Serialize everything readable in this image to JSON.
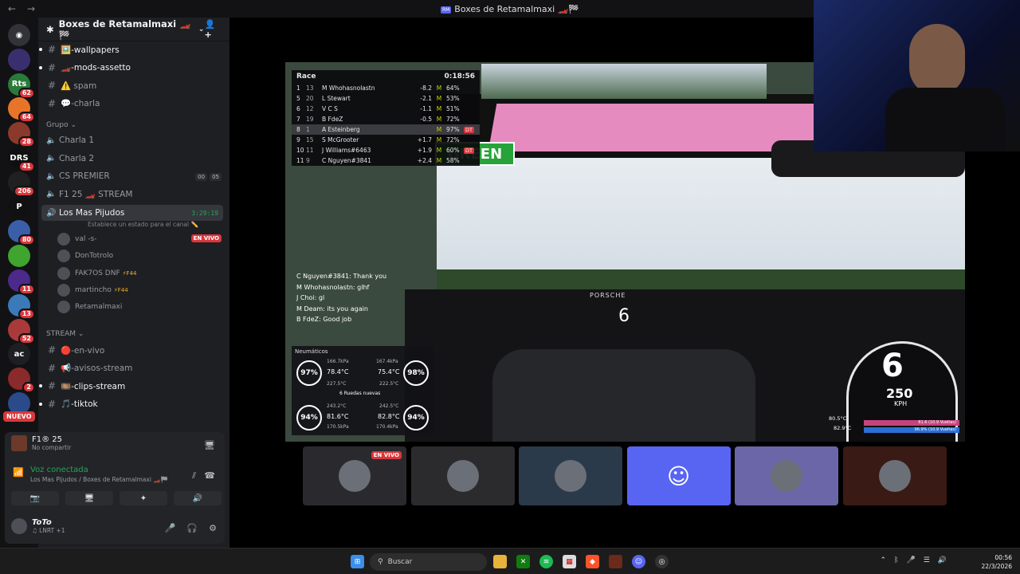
{
  "window": {
    "title": "Boxes de Retamalmaxi 🏎️🏁",
    "badge": "RM",
    "back": "←",
    "forward": "→"
  },
  "servers": [
    {
      "name": "discord-home",
      "count": "",
      "color": "#313338",
      "label": "◉"
    },
    {
      "name": "server-1",
      "count": "",
      "color": "#3a2f6e",
      "label": ""
    },
    {
      "name": "server-2",
      "count": "62",
      "color": "#2a7a3a",
      "label": "Rts"
    },
    {
      "name": "server-3",
      "count": "64",
      "color": "#e8742a",
      "label": ""
    },
    {
      "name": "server-4",
      "count": "28",
      "color": "#8a3a2a",
      "label": ""
    },
    {
      "name": "server-5",
      "count": "41",
      "color": "#101010",
      "label": "DRS"
    },
    {
      "name": "server-6",
      "count": "206",
      "color": "#202020",
      "label": ""
    },
    {
      "name": "server-7",
      "count": "",
      "color": "#111",
      "label": "P"
    },
    {
      "name": "server-8",
      "count": "80",
      "color": "#3a5fa8",
      "label": ""
    },
    {
      "name": "server-9",
      "count": "",
      "color": "#3fa52e",
      "label": ""
    },
    {
      "name": "server-10",
      "count": "11",
      "color": "#4b2a8a",
      "label": ""
    },
    {
      "name": "server-11",
      "count": "13",
      "color": "#3a7ab8",
      "label": ""
    },
    {
      "name": "server-12",
      "count": "52",
      "color": "#a83a3a",
      "label": ""
    },
    {
      "name": "server-13",
      "count": "",
      "color": "#1e1f22",
      "label": "ac"
    },
    {
      "name": "server-14",
      "count": "2",
      "color": "#8a2a2a",
      "label": ""
    },
    {
      "name": "server-15",
      "count": "",
      "color": "#2a4a8a",
      "label": ""
    }
  ],
  "new_badge": "NUEVO",
  "guild": {
    "name": "Boxes de Retamalmaxi 🏎️🏁",
    "chevron": "⌄",
    "invite_icon": "👤+"
  },
  "channels_top": [
    {
      "name": "🖼️-wallpapers",
      "bold": true
    },
    {
      "name": "🏎️-mods-assetto",
      "bold": true
    },
    {
      "name": "⚠️ spam",
      "bold": false
    },
    {
      "name": "💬-charla",
      "bold": false
    }
  ],
  "category_grupo": "Grupo ⌄",
  "voice_channels": [
    {
      "name": "Charla 1",
      "extra": ""
    },
    {
      "name": "Charla 2",
      "extra": ""
    },
    {
      "name": "CS PREMIER",
      "pill1": "00",
      "pill2": "05"
    },
    {
      "name": "F1 25 🏎️ STREAM",
      "extra": ""
    }
  ],
  "active_voice": {
    "name": "Los Mas Pijudos",
    "time": "3:29:19",
    "status": "Establece un estado para el canal ✏️"
  },
  "voice_users": [
    {
      "name": "val -s-",
      "live": "EN VIVO",
      "tag": ""
    },
    {
      "name": "DonTotrolo",
      "live": "",
      "tag": ""
    },
    {
      "name": "FAK7OS DNF",
      "live": "",
      "tag": "⚡F44"
    },
    {
      "name": "martincho",
      "live": "",
      "tag": "⚡F44"
    },
    {
      "name": "Retamalmaxi",
      "live": "",
      "tag": ""
    }
  ],
  "category_stream": "STREAM ⌄",
  "stream_channels": [
    {
      "name": "🔴-en-vivo",
      "bold": false
    },
    {
      "name": "📢-avisos-stream",
      "bold": false
    },
    {
      "name": "🎞️-clips-stream",
      "bold": true
    },
    {
      "name": "🎵-tiktok",
      "bold": true
    }
  ],
  "activity": {
    "title": "F1® 25",
    "subtitle": "No compartir",
    "icon": "🖥"
  },
  "voice_connection": {
    "status": "Voz conectada",
    "location": "Los Mas Pijudos / Boxes de Retamalmaxi 🏎️🏁"
  },
  "voice_buttons": [
    "📷",
    "🖥",
    "✦",
    "🔊"
  ],
  "me": {
    "name": "ToTo",
    "status": "♫ LNRT +1"
  },
  "leaderboard": {
    "title": "Race",
    "clock": "0:18:56",
    "rows": [
      {
        "pos": "1",
        "car": "13",
        "name": "M Whohasnolastn",
        "gap": "-8.2",
        "tyre": "M",
        "pct": "64%",
        "dt": "",
        "hl": false
      },
      {
        "pos": "5",
        "car": "20",
        "name": "L Stewart",
        "gap": "-2.1",
        "tyre": "M",
        "pct": "53%",
        "dt": "",
        "hl": false
      },
      {
        "pos": "6",
        "car": "12",
        "name": "V C S",
        "gap": "-1.1",
        "tyre": "M",
        "pct": "51%",
        "dt": "",
        "hl": false
      },
      {
        "pos": "7",
        "car": "19",
        "name": "B FdeZ",
        "gap": "-0.5",
        "tyre": "M",
        "pct": "72%",
        "dt": "",
        "hl": false
      },
      {
        "pos": "8",
        "car": "1",
        "name": "A Esteinberg",
        "gap": "",
        "tyre": "M",
        "pct": "97%",
        "dt": "DT",
        "hl": true
      },
      {
        "pos": "9",
        "car": "15",
        "name": "S McGrooter",
        "gap": "+1.7",
        "tyre": "M",
        "pct": "72%",
        "dt": "",
        "hl": false
      },
      {
        "pos": "10",
        "car": "11",
        "name": "J Williams#6463",
        "gap": "+1.9",
        "tyre": "M",
        "pct": "60%",
        "dt": "DT",
        "hl": false
      },
      {
        "pos": "11",
        "car": "9",
        "name": "C Nguyen#3841",
        "gap": "+2.4",
        "tyre": "M",
        "pct": "58%",
        "dt": "",
        "hl": false
      }
    ]
  },
  "green_flag": "GREEN",
  "chat": [
    "C Nguyen#3841: Thank you",
    "M Whohasnolastn: glhf",
    "J Choi: gl",
    "M Deam: its you again",
    "B FdeZ: Good job"
  ],
  "tyres": {
    "header": "Neumáticos",
    "fl": "97%",
    "fr": "98%",
    "rl": "94%",
    "rr": "94%",
    "fl_temp": "78.4°C",
    "fr_temp": "75.4°C",
    "rl_temp": "81.6°C",
    "rr_temp": "82.8°C",
    "fl_p": "166.7kPa",
    "fr_p": "167.4kPa",
    "rl_p": "170.5kPa",
    "rr_p": "170.4kPa",
    "fl_c": "227.5°C",
    "fr_c": "222.5°C",
    "rl_c": "243.2°C",
    "rr_c": "242.5°C",
    "middle": "6 Ruedas nuevas"
  },
  "hud": {
    "gear": "6",
    "speed": "250",
    "unit": "KPH",
    "fuel1": "81.6 (10.9 Vueltas)",
    "fuel2": "96.9% (10.9 Vueltas)",
    "t1": "80.5°C",
    "t2": "82.9°C"
  },
  "dash_gear": "6",
  "dash_brand": "PORSCHE",
  "thumbs": [
    {
      "name": "stream-thumb",
      "live": "EN VIVO",
      "bg": "#2a2a2e"
    },
    {
      "name": "user-thumb-1",
      "live": "",
      "bg": "#2b2b2d"
    },
    {
      "name": "user-thumb-2",
      "live": "",
      "bg": "#2a3a4a"
    },
    {
      "name": "discord-thumb",
      "live": "",
      "bg": "#5865f2"
    },
    {
      "name": "user-thumb-3",
      "live": "",
      "bg": "#6b66a8"
    },
    {
      "name": "user-thumb-4",
      "live": "",
      "bg": "#3a1a14"
    }
  ],
  "taskbar": {
    "search": "Buscar",
    "time": "00:56",
    "date": "22/3/2026"
  }
}
